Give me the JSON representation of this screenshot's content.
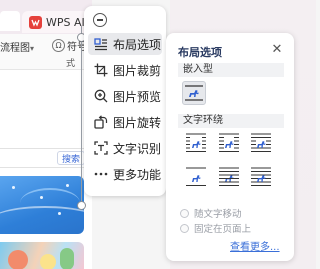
{
  "background_app": {
    "tab_title": "WPS AI",
    "toolbar_left_label": "流程图",
    "symbol_label": "符号",
    "toolbar_right_fragment": "式",
    "search_button": "搜索"
  },
  "context_toolbar": {
    "items": [
      {
        "label": "布局选项",
        "icon": "layout-options-icon",
        "active": true
      },
      {
        "label": "图片裁剪",
        "icon": "crop-icon",
        "active": false
      },
      {
        "label": "图片预览",
        "icon": "zoom-in-icon",
        "active": false
      },
      {
        "label": "图片旋转",
        "icon": "rotate-icon",
        "active": false
      },
      {
        "label": "文字识别",
        "icon": "text-recognition-icon",
        "active": false
      },
      {
        "label": "更多功能",
        "icon": "more-icon",
        "active": false
      }
    ]
  },
  "layout_panel": {
    "title": "布局选项",
    "section_inline": "嵌入型",
    "section_wrap": "文字环绕",
    "inline_options": [
      {
        "icon": "inline-icon",
        "selected": true
      }
    ],
    "wrap_options": [
      {
        "icon": "square-wrap-icon"
      },
      {
        "icon": "tight-wrap-icon"
      },
      {
        "icon": "through-wrap-icon"
      },
      {
        "icon": "top-bottom-wrap-icon"
      },
      {
        "icon": "behind-text-icon"
      },
      {
        "icon": "in-front-of-text-icon"
      }
    ],
    "move_with_text": "随文字移动",
    "fix_on_page": "固定在页面上",
    "see_more": "查看更多..."
  },
  "colors": {
    "accent_blue": "#2f5fd0",
    "link_blue": "#3a6fd8",
    "title_navy": "#2a3b62",
    "wps_red": "#e5413c"
  }
}
